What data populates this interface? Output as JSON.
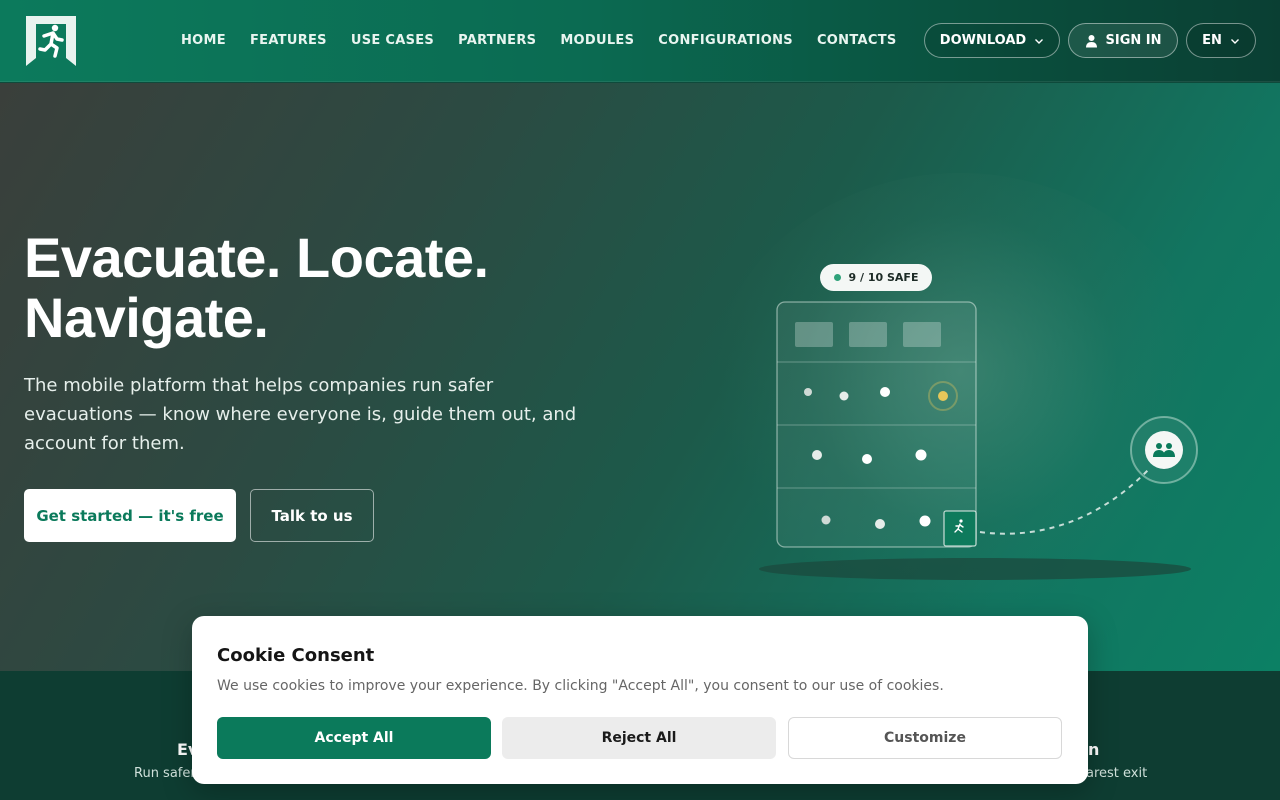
{
  "header": {
    "nav": [
      "HOME",
      "FEATURES",
      "USE CASES",
      "PARTNERS",
      "MODULES",
      "CONFIGURATIONS",
      "CONTACTS"
    ],
    "download_label": "DOWNLOAD",
    "signin_label": "SIGN IN",
    "lang_label": "EN"
  },
  "hero": {
    "title": "Evacuate. Locate.\nNavigate.",
    "subtitle": "The mobile platform that helps companies run safer evacuations — know where everyone is, guide them out, and account for them.",
    "cta_primary": "Get started — it's free",
    "cta_secondary": "Talk to us",
    "safe_status": "9 / 10 SAFE"
  },
  "strip": {
    "left_title": "Ev",
    "left_text": "Run safer",
    "right_title": "n",
    "right_text": "earest exit"
  },
  "cookie": {
    "title": "Cookie Consent",
    "text": "We use cookies to improve your experience. By clicking \"Accept All\", you consent to our use of cookies.",
    "accept": "Accept All",
    "reject": "Reject All",
    "customize": "Customize"
  },
  "colors": {
    "brand_green": "#0b7a5b",
    "alert_yellow": "#e6c75a"
  },
  "icons": [
    "emergency-exit-logo-icon",
    "chevron-down-icon",
    "user-icon",
    "running-person-icon",
    "group-icon"
  ]
}
